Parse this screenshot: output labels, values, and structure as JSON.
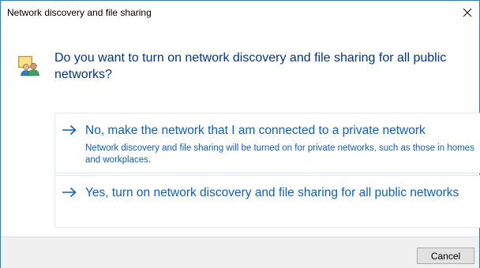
{
  "window": {
    "title": "Network discovery and file sharing",
    "close_icon": "close-icon"
  },
  "main": {
    "icon": "network-users-icon",
    "instruction": "Do you want to turn on network discovery and file sharing for all public networks?"
  },
  "options": [
    {
      "icon": "arrow-right-icon",
      "title": "No, make the network that I am connected to a private network",
      "description": "Network discovery and file sharing will be turned on for private networks, such as those in homes and workplaces."
    },
    {
      "icon": "arrow-right-icon",
      "title": "Yes, turn on network discovery and file sharing for all public networks"
    }
  ],
  "footer": {
    "cancel_label": "Cancel"
  },
  "colors": {
    "window_border": "#1883d7",
    "instruction_text": "#003399",
    "link_text": "#0a5ecf",
    "footer_background": "#f0f0f0"
  }
}
